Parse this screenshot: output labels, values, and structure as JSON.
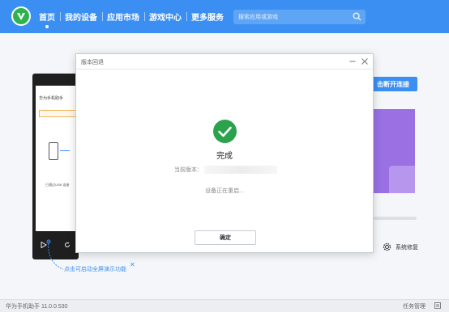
{
  "topbar": {
    "nav": [
      "首页",
      "我的设备",
      "应用市场",
      "游戏中心",
      "更多服务"
    ],
    "active_index": 0,
    "search_placeholder": "搜索应用或游戏"
  },
  "background": {
    "phone_brand": "华为手机助手",
    "phone_text": "已通过USB 连接",
    "hint_text": "点击可启动全屏演示功能",
    "disconnect_label": "击断开连接",
    "sys_settings_label": "系统修复"
  },
  "statusbar": {
    "version": "华为手机助手 11.0.0.530",
    "task_manager": "任务管理"
  },
  "dialog": {
    "title": "版本回退",
    "status_title": "完成",
    "current_version_label": "当前版本：",
    "restarting_text": "设备正在重启...",
    "ok_label": "确定"
  },
  "colors": {
    "accent": "#3b8ff3",
    "success": "#2ba24c",
    "purple": "#9a70e2"
  }
}
